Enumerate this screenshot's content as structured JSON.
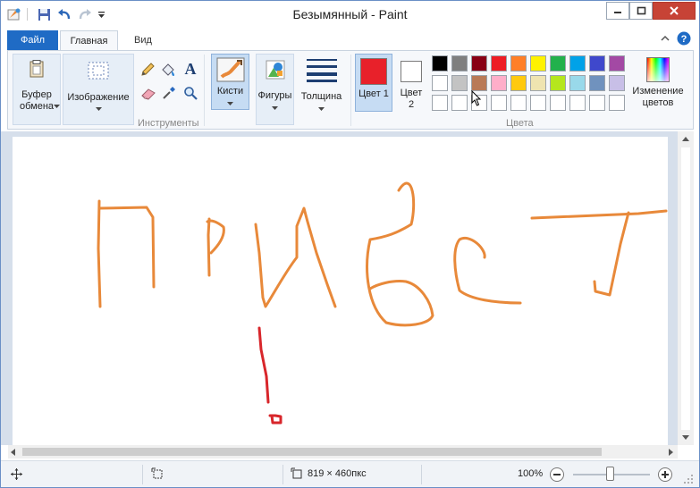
{
  "window": {
    "title": "Безымянный - Paint"
  },
  "tabs": {
    "file": "Файл",
    "home": "Главная",
    "view": "Вид"
  },
  "ribbon": {
    "clipboard": "Буфер обмена",
    "image": "Изображение",
    "tools_group": "Инструменты",
    "brushes": "Кисти",
    "shapes": "Фигуры",
    "thickness": "Толщина",
    "color1": "Цвет 1",
    "color2": "Цвет 2",
    "colors_group": "Цвета",
    "edit_colors": "Изменение цветов",
    "color1_value": "#e8212a",
    "color2_value": "#ffffff",
    "palette_row1": [
      "#000000",
      "#7f7f7f",
      "#880015",
      "#ed1c24",
      "#ff7f27",
      "#fff200",
      "#22b14c",
      "#00a2e8",
      "#3f48cc",
      "#a349a4"
    ],
    "palette_row2": [
      "#ffffff",
      "#c3c3c3",
      "#b97a57",
      "#ffaec9",
      "#ffc90e",
      "#efe4b0",
      "#b5e61d",
      "#99d9ea",
      "#7092be",
      "#c8bfe7"
    ],
    "palette_row3": [
      "#ffffff",
      "#ffffff",
      "#ffffff",
      "#ffffff",
      "#ffffff",
      "#ffffff",
      "#ffffff",
      "#ffffff",
      "#ffffff",
      "#ffffff"
    ]
  },
  "statusbar": {
    "image_size": "819 × 460пкс",
    "zoom": "100%"
  },
  "colors": {
    "stroke_orange": "#e8893a",
    "stroke_red": "#d8262b",
    "accent_blue": "#1f6bc5"
  }
}
